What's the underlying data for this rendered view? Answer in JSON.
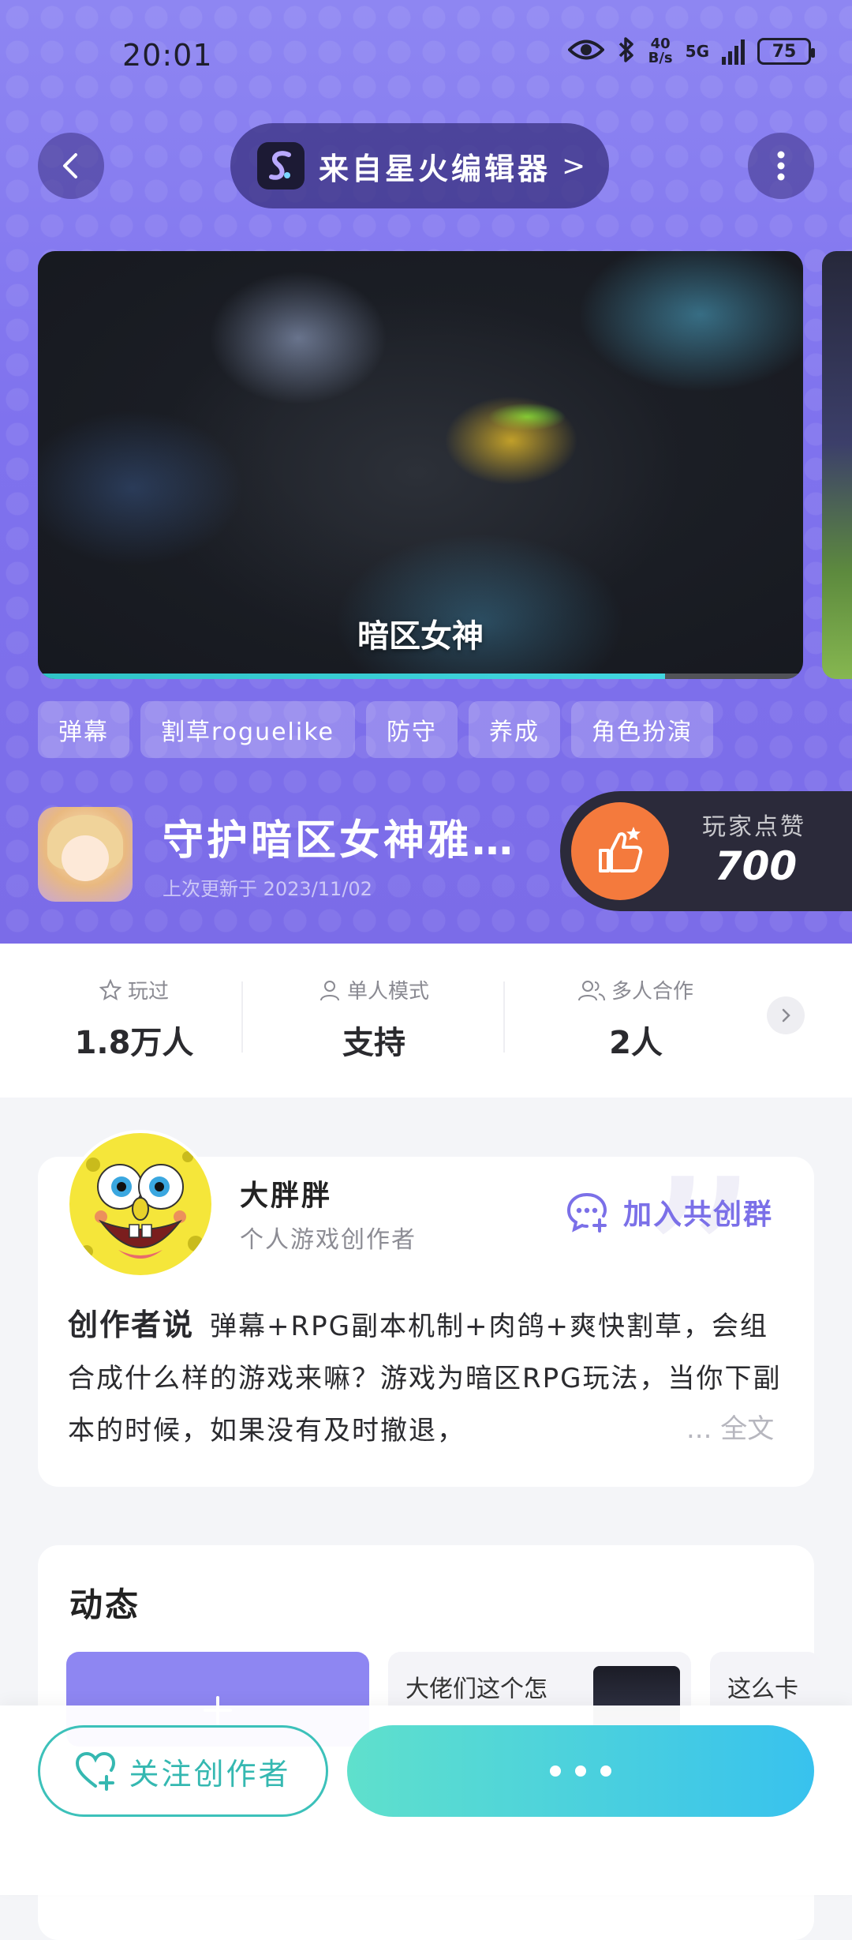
{
  "status_bar": {
    "time": "20:01",
    "net_speed_top": "40",
    "net_speed_bottom": "B/s",
    "network": "5G",
    "battery": "75"
  },
  "header": {
    "source_label": "来自星火编辑器",
    "source_chevron": ">"
  },
  "media": {
    "caption": "暗区女神",
    "progress_fraction": 0.82
  },
  "tags": [
    "弹幕",
    "割草roguelike",
    "防守",
    "养成",
    "角色扮演"
  ],
  "game": {
    "title": "守护暗区女神雅…",
    "updated": "上次更新于 2023/11/02",
    "likes_label": "玩家点赞",
    "likes_count": "700"
  },
  "stats": [
    {
      "label": "玩过",
      "value": "1.8万人",
      "icon": "star-icon"
    },
    {
      "label": "单人模式",
      "value": "支持",
      "icon": "person-icon"
    },
    {
      "label": "多人合作",
      "value": "2人",
      "icon": "people-icon"
    }
  ],
  "creator": {
    "name": "大胖胖",
    "role": "个人游戏创作者",
    "join_label": "加入共创群",
    "say_label": "创作者说",
    "description": "弹幕+RPG副本机制+肉鸽+爽快割草，会组合成什么样的游戏来嘛？游戏为暗区RPG玩法，当你下副本的时候，如果没有及时撤退，",
    "read_more": "... 全文"
  },
  "dynamics": {
    "title": "动态",
    "items": [
      "",
      "大佬们这个怎",
      "这么卡"
    ]
  },
  "bottom": {
    "follow_label": "关注创作者"
  },
  "colors": {
    "hero": "#7f72ee",
    "accent_teal": "#3cc1ba",
    "like_orange": "#f47a3d",
    "creator_accent": "#7b70e8"
  }
}
